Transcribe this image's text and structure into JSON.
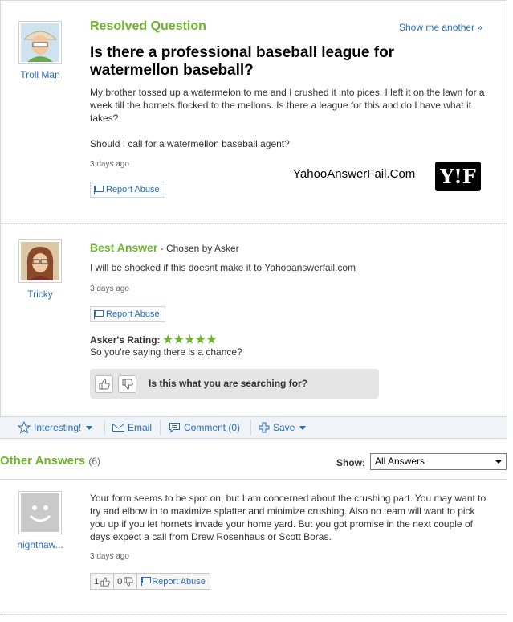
{
  "question": {
    "label": "Resolved Question",
    "show_another": "Show me another »",
    "title": "Is there a professional baseball league for watermellon baseball?",
    "body_p1": "My brother tossed up a watermelon to me and I crushed it into pices. I left it on the lawn for a week till the hornets flocked to the mellons. Is there a league for this and do I have what it takes?",
    "body_p2": "Should I call for a watermellon baseball agent?",
    "date": "3 days ago",
    "report_abuse": "Report Abuse",
    "asker_name": "Troll Man"
  },
  "watermark": {
    "text": "YahooAnswerFail.Com",
    "logo_text": "Y!F"
  },
  "best_answer": {
    "label": "Best Answer",
    "chosen_by": " - Chosen by Asker",
    "text": "I will be shocked if this doesnt make it to Yahooanswerfail.com",
    "date": "3 days ago",
    "report_abuse": "Report Abuse",
    "answerer_name": "Tricky",
    "askers_rating_label": "Asker's Rating:",
    "rating_stars": "★★★★★",
    "rating_comment": "So you're saying there is a chance?",
    "search_prompt": "Is this what you are searching for?"
  },
  "toolbar": {
    "interesting": "Interesting!",
    "email": "Email",
    "comment": "Comment (0)",
    "save": "Save"
  },
  "other_answers": {
    "title": "Other Answers",
    "count": "(6)",
    "show_label": "Show:",
    "show_selected": "All Answers"
  },
  "answer2": {
    "name": "nighthaw...",
    "body": "Your form seems to be spot on, but I am concerned about the crushing part. You may want to try and elbow in to maximize splatter and minimize crushing. Also no team will want to pick you up if you let hornets invade your home yard. But you got promise in the next couple of days expect a call from Drew Rosenhaus or Scott Boras.",
    "date": "3 days ago",
    "thumbs_up": "1",
    "thumbs_down": "0",
    "report_abuse": "Report Abuse"
  },
  "colors": {
    "green": "#6eb52d",
    "link_blue": "#2a6ebb"
  }
}
